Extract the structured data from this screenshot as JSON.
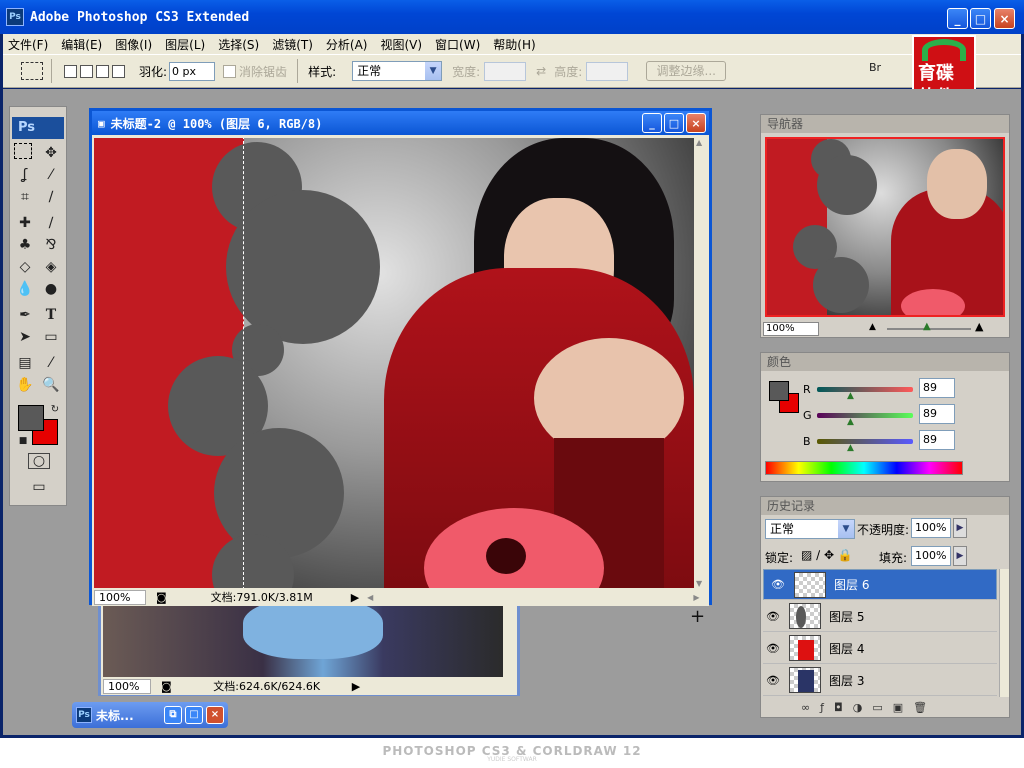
{
  "app": {
    "title": "Adobe Photoshop CS3 Extended",
    "icon": "Ps",
    "min": "_",
    "max": "□",
    "close": "×"
  },
  "menu": [
    "文件(F)",
    "编辑(E)",
    "图像(I)",
    "图层(L)",
    "选择(S)",
    "滤镜(T)",
    "分析(A)",
    "视图(V)",
    "窗口(W)",
    "帮助(H)"
  ],
  "options": {
    "feather_label": "羽化:",
    "feather_value": "0 px",
    "antialias_label": "消除锯齿",
    "style_label": "样式:",
    "style_value": "正常",
    "width_label": "宽度:",
    "height_label": "高度:",
    "refine_label": "调整边缘..."
  },
  "logo": {
    "text1": "育碟",
    "text2": "软件"
  },
  "toolbox": {
    "title": "Ps"
  },
  "doc_main": {
    "title": "未标题-2 @ 100% (图层 6, RGB/8)",
    "zoom": "100%",
    "info": "文档:791.0K/3.81M"
  },
  "doc_back": {
    "zoom": "100%",
    "info": "文档:624.6K/624.6K"
  },
  "minimized": {
    "title": "未标..."
  },
  "navigator": {
    "title": "导航器",
    "zoom": "100%"
  },
  "color": {
    "title": "颜色",
    "labels": [
      "R",
      "G",
      "B"
    ],
    "values": [
      "89",
      "89",
      "89"
    ],
    "foreground": "#595959",
    "background": "#e60000"
  },
  "history": {
    "title": "历史记录"
  },
  "layers": {
    "blend": "正常",
    "opacity_label": "不透明度:",
    "opacity": "100%",
    "lock_label": "锁定:",
    "fill_label": "填充:",
    "fill": "100%",
    "items": [
      {
        "name": "图层 6",
        "selected": true
      },
      {
        "name": "图层 5",
        "selected": false
      },
      {
        "name": "图层 4",
        "selected": false
      },
      {
        "name": "图层 3",
        "selected": false
      }
    ]
  },
  "footer": {
    "text": "PHOTOSHOP CS3 & CORLDRAW 12",
    "sub": "YUDIE SOFTWAR"
  }
}
